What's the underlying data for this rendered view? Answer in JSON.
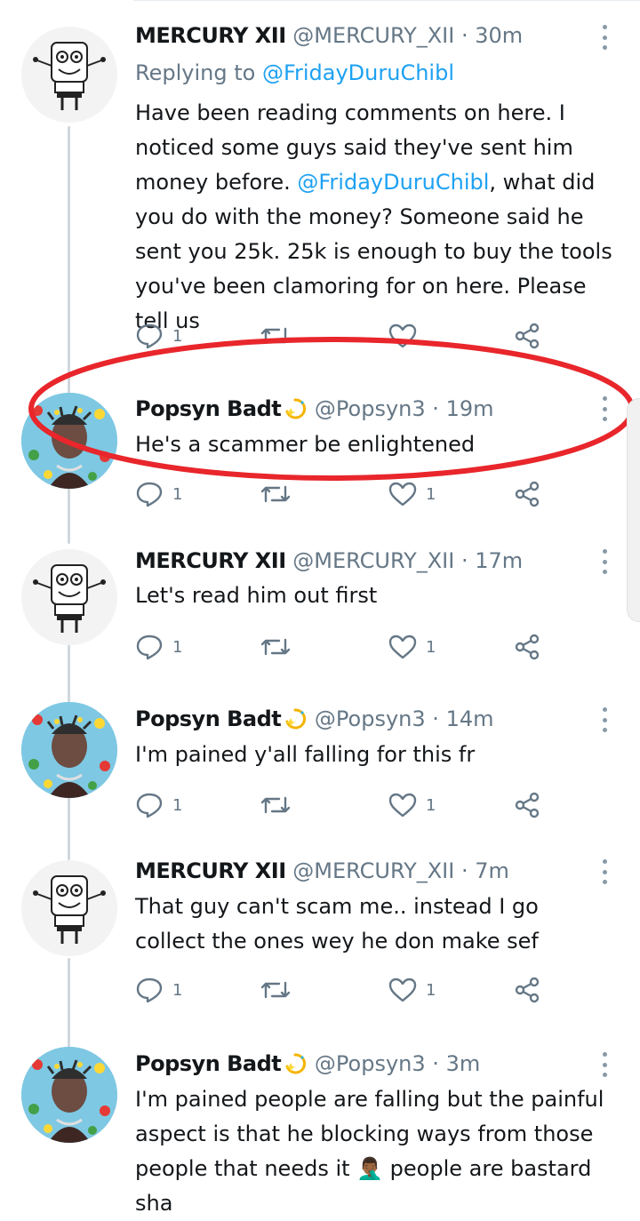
{
  "tweets": [
    {
      "name": "MERCURY XII",
      "handle": "@MERCURY_XII",
      "dot": "·",
      "time": "30m",
      "replying_prefix": "Replying to ",
      "replying_to": "@FridayDuruChibl",
      "body_part1": "Have been reading comments on here. I noticed some guys said they've sent him money before. ",
      "body_mention": "@FridayDuruChibl",
      "body_part2": ", what did you do with the money? Someone said he sent you 25k. 25k is enough to buy the tools you've been clamoring for on here. Please tell us",
      "reply_count": "1",
      "retweet_count": "",
      "like_count": ""
    },
    {
      "name": "Popsyn Badt",
      "handle": "@Popsyn3",
      "dot": "·",
      "time": "19m",
      "body": "He's a scammer be enlightened",
      "reply_count": "1",
      "retweet_count": "",
      "like_count": "1"
    },
    {
      "name": "MERCURY XII",
      "handle": "@MERCURY_XII",
      "dot": "·",
      "time": "17m",
      "body": "Let's read him out first",
      "reply_count": "1",
      "retweet_count": "",
      "like_count": "1"
    },
    {
      "name": "Popsyn Badt",
      "handle": "@Popsyn3",
      "dot": "·",
      "time": "14m",
      "body": "I'm pained y'all falling for this fr",
      "reply_count": "1",
      "retweet_count": "",
      "like_count": "1"
    },
    {
      "name": "MERCURY XII",
      "handle": "@MERCURY_XII",
      "dot": "·",
      "time": "7m",
      "body": "That guy can't scam me.. instead I go collect the ones wey he don make sef",
      "reply_count": "1",
      "retweet_count": "",
      "like_count": "1"
    },
    {
      "name": "Popsyn Badt",
      "handle": "@Popsyn3",
      "dot": "·",
      "time": "3m",
      "body": "I'm pained people are falling but the painful aspect is that he blocking ways from those people that needs it 🤦🏾‍♂️ people are bastard sha"
    }
  ],
  "colors": {
    "link": "#1da1f2",
    "muted": "#657786",
    "annotation": "#e8262b"
  },
  "icons": {
    "reply": "reply-icon",
    "retweet": "retweet-icon",
    "like": "heart-icon",
    "share": "share-icon",
    "more": "more-vertical-icon"
  }
}
